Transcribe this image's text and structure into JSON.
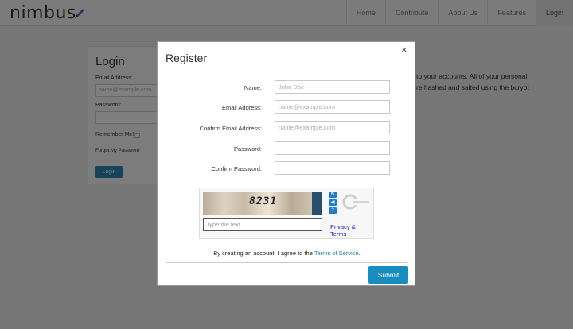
{
  "header": {
    "logo": "nimbus",
    "nav": [
      "Home",
      "Contribute",
      "About Us",
      "Features",
      "Login"
    ]
  },
  "login_panel": {
    "title": "Login",
    "email_label": "Email Address:",
    "email_placeholder": "name@example.com",
    "password_label": "Password:",
    "remember_label": "Remember Me!",
    "forgot_link": "Forgot My Password",
    "login_button": "Login"
  },
  "background_text": {
    "line1": "to your accounts. All of your personal",
    "line2": "re hashed and salted using the bcrypt"
  },
  "modal": {
    "title": "Register",
    "close": "×",
    "fields": {
      "name": {
        "label": "Name:",
        "placeholder": "John Doe",
        "value": ""
      },
      "email": {
        "label": "Email Address:",
        "placeholder": "name@example.com",
        "value": ""
      },
      "confirm_email": {
        "label": "Confirm Email Address:",
        "placeholder": "name@example.com",
        "value": ""
      },
      "password": {
        "label": "Password:",
        "placeholder": "",
        "value": ""
      },
      "confirm_password": {
        "label": "Confirm Password:",
        "placeholder": "",
        "value": ""
      }
    },
    "captcha": {
      "image_text": "8231",
      "input_placeholder": "Type the text",
      "privacy_link": "Privacy & Terms",
      "icons": [
        "refresh-icon",
        "audio-icon",
        "help-icon"
      ]
    },
    "agreement": {
      "prefix": "By creating an account, I agree to the",
      "link": "Terms of Service",
      "suffix": "."
    },
    "submit": "Submit"
  },
  "colors": {
    "accent": "#168dbd",
    "link": "#1c7fa8",
    "overlay": "rgba(0,0,0,0.5)"
  }
}
